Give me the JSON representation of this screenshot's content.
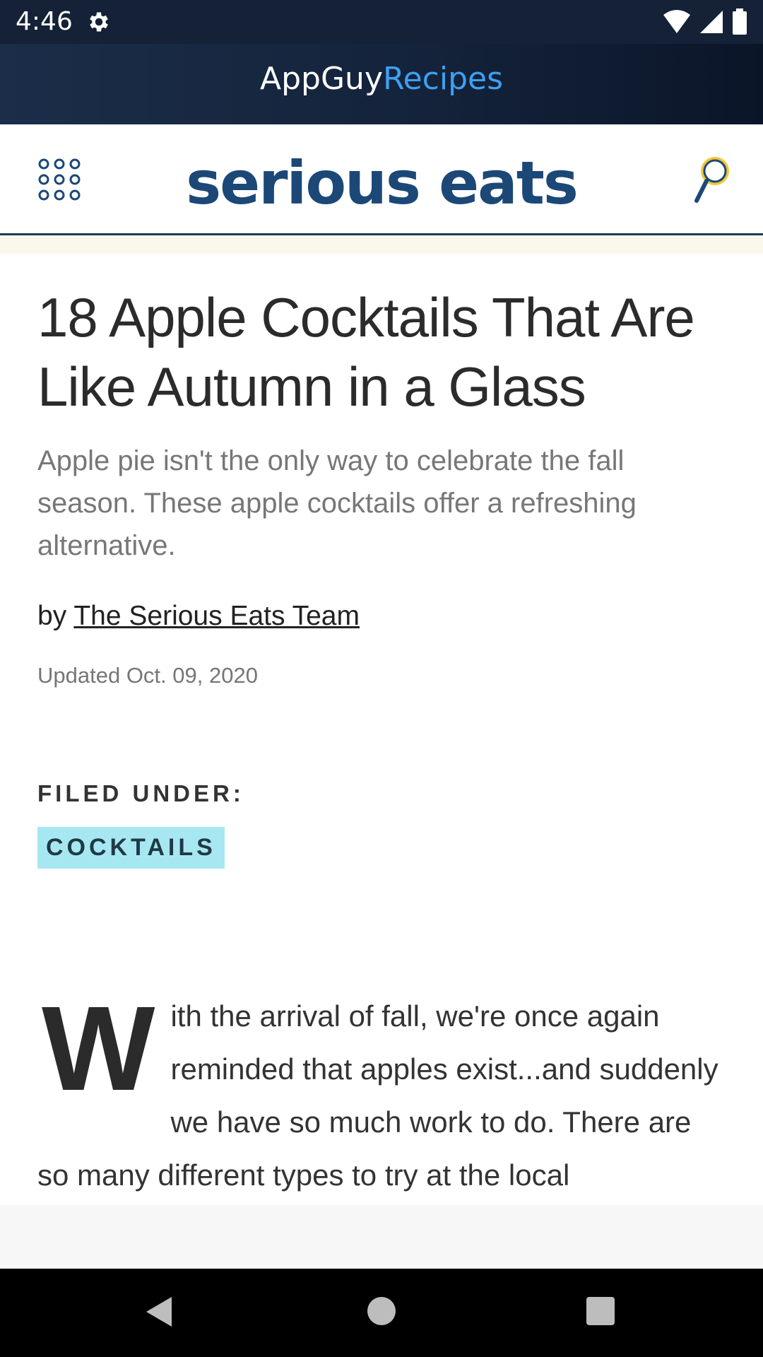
{
  "status_bar": {
    "time": "4:46"
  },
  "app_bar": {
    "title_part1": "AppGuy",
    "title_part2": "Recipes",
    "accent": "#3fa0f0"
  },
  "site_header": {
    "logo_text": "serious eats",
    "logo_color": "#1c4877"
  },
  "article": {
    "headline": "18 Apple Cocktails That Are Like Autumn in a Glass",
    "dek": "Apple pie isn't the only way to celebrate the fall season. These apple cocktails offer a refreshing alternative.",
    "byline_prefix": "by",
    "author": "The Serious Eats Team",
    "updated": "Updated Oct. 09, 2020",
    "filed_under_label": "FILED UNDER:",
    "tag": "COCKTAILS",
    "tag_color": "#a6e7f2",
    "dropcap": "W",
    "body": "ith the arrival of fall, we're once again reminded that apples exist...and suddenly we have so much work to do. There are so many different types to try at the local"
  },
  "icons": {
    "status": [
      "gear-icon",
      "wifi-icon",
      "signal-icon",
      "battery-icon"
    ],
    "header": [
      "apps-grid-icon",
      "search-icon"
    ],
    "nav": [
      "back-icon",
      "home-icon",
      "recents-icon"
    ]
  }
}
